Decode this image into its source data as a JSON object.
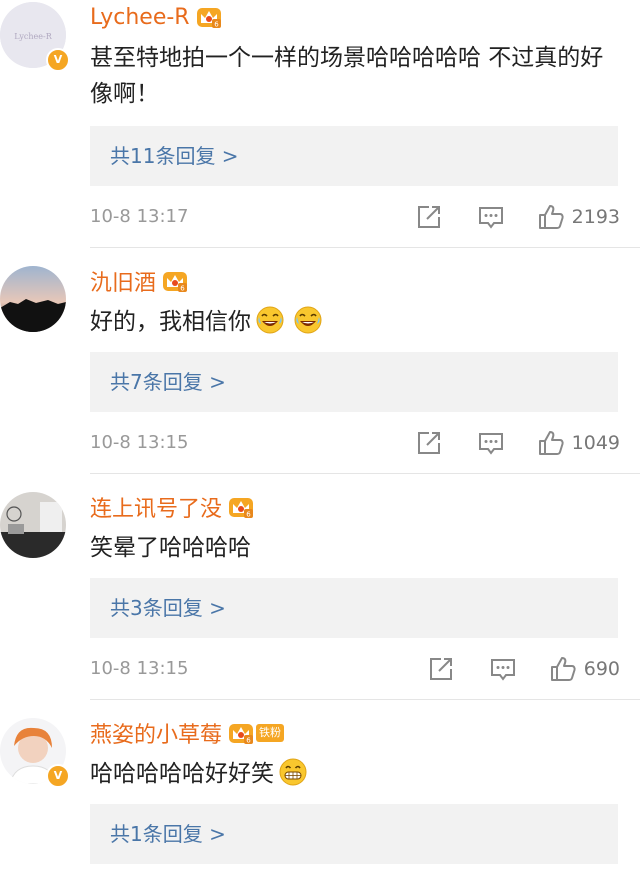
{
  "comments": [
    {
      "username": "Lychee-R",
      "avatar_text": "Lychee-R",
      "verified": true,
      "text": "甚至特地拍一个一样的场景哈哈哈哈哈 不过真的好像啊！",
      "reply_label": "共11条回复 >",
      "timestamp": "10-8 13:17",
      "likes": "2193"
    },
    {
      "username": "氿旧酒",
      "verified": false,
      "text": "好的，我相信你",
      "emojis": [
        "laughing-tears-emoji",
        "laughing-tears-emoji"
      ],
      "reply_label": "共7条回复 >",
      "timestamp": "10-8 13:15",
      "likes": "1049"
    },
    {
      "username": "连上讯号了没",
      "verified": false,
      "text": "笑晕了哈哈哈哈",
      "reply_label": "共3条回复 >",
      "timestamp": "10-8 13:15",
      "likes": "690"
    },
    {
      "username": "燕姿的小草莓",
      "verified": true,
      "fan_badge": "铁粉",
      "text": "哈哈哈哈哈好好笑",
      "emojis": [
        "grinning-emoji"
      ],
      "reply_label": "共1条回复 >"
    }
  ],
  "icons": {
    "verified": "v-verified-icon",
    "crown": "crown-badge-icon",
    "share": "share-icon",
    "comment": "comment-icon",
    "like": "thumbs-up-icon"
  },
  "colors": {
    "username": "#e86b1c",
    "reply_link": "#4a76a8",
    "reply_bg": "#f2f2f2",
    "badge": "#f5a623"
  }
}
